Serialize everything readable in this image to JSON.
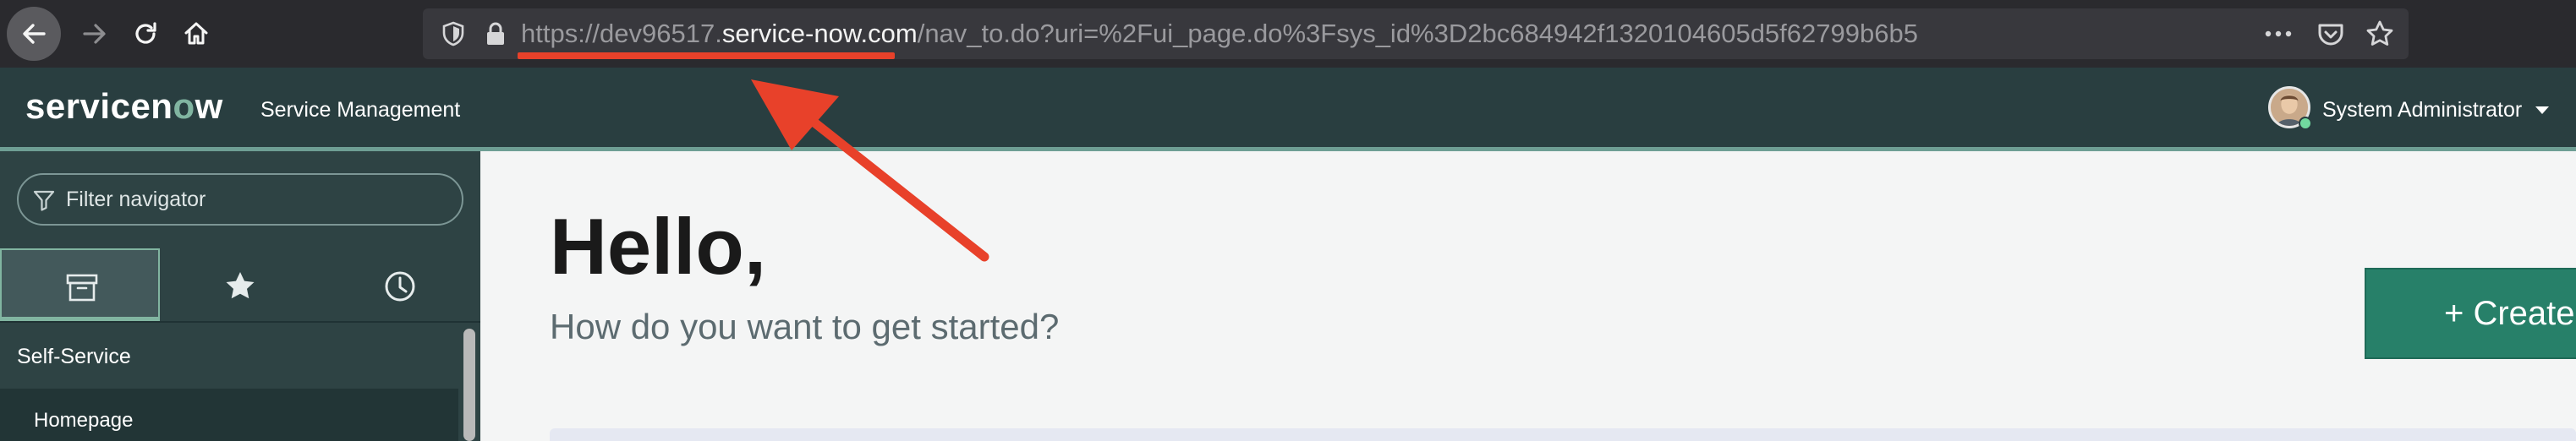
{
  "browser": {
    "url_prefix": "https://dev96517.",
    "url_host": "service-now.com",
    "url_path": "/nav_to.do?uri=%2Fui_page.do%3Fsys_id%3D2bc684942f1320104605d5f62799b6b5",
    "icons": {
      "back": "back-arrow-icon",
      "forward": "forward-arrow-icon",
      "reload": "reload-icon",
      "home": "home-icon",
      "shield": "tracking-shield-icon",
      "lock": "lock-icon",
      "more": "more-dots-icon",
      "pocket": "pocket-icon",
      "bookmark": "star-icon"
    },
    "annotation_color": "#e8412a"
  },
  "header": {
    "logo_prefix": "servicen",
    "logo_o": "o",
    "logo_suffix": "w",
    "product": "Service Management",
    "user_name": "System Administrator",
    "colors": {
      "header_bg": "#293e40",
      "accent": "#81b5a1"
    }
  },
  "nav": {
    "filter_placeholder": "Filter navigator",
    "tabs": [
      {
        "name": "all-apps",
        "icon": "archive-box-icon",
        "active": true
      },
      {
        "name": "favorites",
        "icon": "star-icon",
        "active": false
      },
      {
        "name": "history",
        "icon": "clock-icon",
        "active": false
      }
    ],
    "application": "Self-Service",
    "modules": [
      "Homepage"
    ]
  },
  "main": {
    "greeting": "Hello,",
    "subtitle": "How do you want to get started?",
    "create_label": "+ Create",
    "colors": {
      "create_bg": "#278069"
    }
  }
}
